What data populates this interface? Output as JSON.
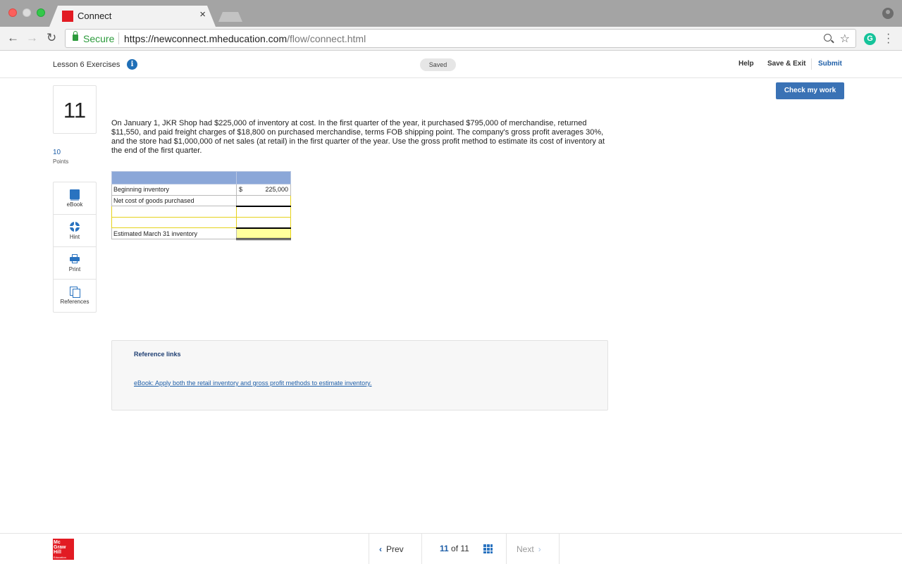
{
  "browser": {
    "tab_title": "Connect",
    "tab_close": "×",
    "secure_label": "Secure",
    "url_host": "https://newconnect.mheducation.com",
    "url_path": "/flow/connect.html",
    "grammarly_label": "G"
  },
  "header": {
    "lesson_title": "Lesson 6 Exercises",
    "info_icon": "i",
    "saved_badge": "Saved",
    "help": "Help",
    "save_exit": "Save & Exit",
    "submit": "Submit"
  },
  "check_button": "Check my work",
  "question": {
    "number": "11",
    "points_value": "10",
    "points_label": "Points",
    "text": "On January 1, JKR Shop had $225,000 of inventory at cost. In the first quarter of the year, it purchased $795,000 of merchandise, returned $11,550, and paid freight charges of $18,800 on purchased merchandise, terms FOB shipping point. The company's gross profit averages 30%, and the store had $1,000,000 of net sales (at retail) in the first quarter of the year. Use the gross profit method to estimate its cost of inventory at the end of the first quarter."
  },
  "tools": [
    {
      "label": "eBook",
      "icon": "book-icon"
    },
    {
      "label": "Hint",
      "icon": "lifebuoy-icon"
    },
    {
      "label": "Print",
      "icon": "printer-icon"
    },
    {
      "label": "References",
      "icon": "copy-icon"
    }
  ],
  "worksheet": {
    "rows": [
      {
        "label": "Beginning inventory",
        "currency": "$",
        "value": "225,000"
      },
      {
        "label": "Net cost of goods purchased",
        "currency": "",
        "value": ""
      },
      {
        "label": "",
        "currency": "",
        "value": ""
      },
      {
        "label": "",
        "currency": "",
        "value": ""
      },
      {
        "label": "Estimated March 31 inventory",
        "currency": "",
        "value": ""
      }
    ]
  },
  "references": {
    "title": "Reference links",
    "link": "eBook: Apply both the retail inventory and gross profit methods to estimate inventory."
  },
  "footer": {
    "logo_lines": [
      "Mc",
      "Graw",
      "Hill"
    ],
    "logo_sub": "Education",
    "prev": "Prev",
    "current": "11",
    "of": "of",
    "total": "11",
    "next": "Next"
  },
  "colors": {
    "accent": "#1f5fa8",
    "check_button": "#3a72b5",
    "worksheet_header": "#8ba7d8",
    "input_highlight": "#ffff9d",
    "brand_red": "#e21b23"
  }
}
